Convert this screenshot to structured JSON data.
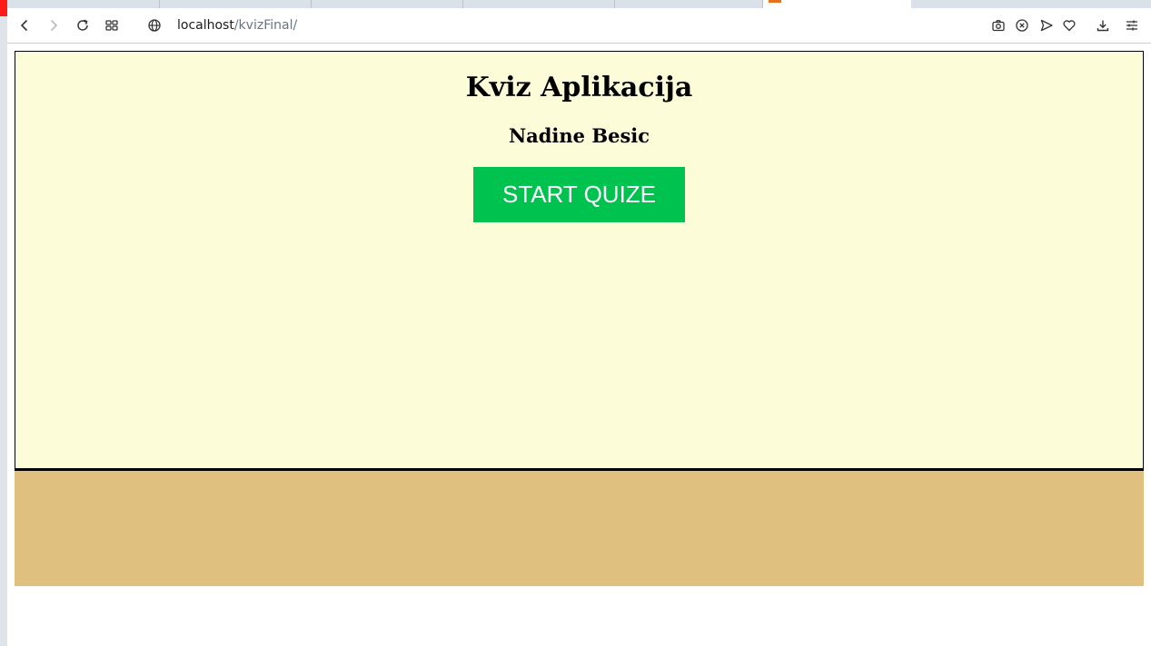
{
  "browser": {
    "url_host": "localhost",
    "url_path": "/kvizFinal/",
    "icons": {
      "back": "back-arrow-icon",
      "forward": "forward-arrow-icon",
      "reload": "reload-icon",
      "tab_grid": "tab-grid-icon",
      "site_info": "globe-icon",
      "snapshot": "camera-icon",
      "tracker_block": "shield-x-icon",
      "send": "send-arrow-icon",
      "bookmark": "heart-icon",
      "download": "download-icon",
      "settings": "sliders-icon"
    }
  },
  "quiz": {
    "title": "Kviz Aplikacija",
    "author": "Nadine Besic",
    "start_label": "START QUIZE"
  },
  "colors": {
    "quiz_background": "#fcfcd9",
    "start_button": "#00c24e",
    "footer_band": "#dfc07e",
    "tab_favicon": "#e8711c"
  }
}
